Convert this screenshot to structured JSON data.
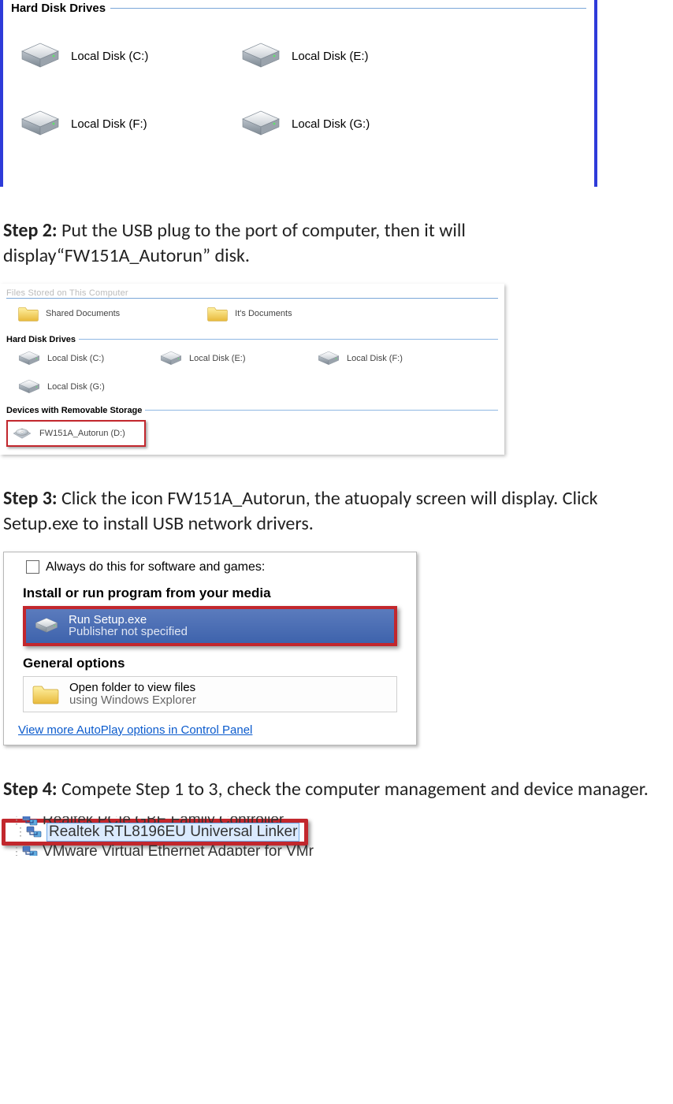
{
  "shot1": {
    "header": "Hard Disk Drives",
    "drives": [
      {
        "label": "Local Disk (C:)"
      },
      {
        "label": "Local Disk (E:)"
      },
      {
        "label": "Local Disk (F:)"
      },
      {
        "label": "Local Disk (G:)"
      }
    ]
  },
  "step2": {
    "label": "Step 2:",
    "text": " Put the USB plug to the port of computer, then it will display“FW151A_Autorun” disk."
  },
  "shot2": {
    "top_header": "Files Stored on This Computer",
    "docs": [
      {
        "label": "Shared Documents"
      },
      {
        "label": "It's Documents"
      }
    ],
    "hdd_header": "Hard Disk Drives",
    "drives": [
      {
        "label": "Local Disk (C:)"
      },
      {
        "label": "Local Disk (E:)"
      },
      {
        "label": "Local Disk (F:)"
      },
      {
        "label": "Local Disk (G:)"
      }
    ],
    "removable_header": "Devices with Removable Storage",
    "removable": {
      "label": "FW151A_Autorun (D:)"
    }
  },
  "step3": {
    "label": "Step 3:",
    "text": " Click the icon FW151A_Autorun, the atuopaly screen will display. Click Setup.exe to install USB network drivers."
  },
  "shot3": {
    "always": "Always do this for software and games:",
    "group1": "Install or run program from your media",
    "opt1_line1": "Run Setup.exe",
    "opt1_line2": "Publisher not specified",
    "group2": "General options",
    "opt2_line1": "Open folder to view files",
    "opt2_line2": "using Windows Explorer",
    "link": "View more AutoPlay options in Control Panel"
  },
  "step4": {
    "label": "Step 4:",
    "text": " Compete Step 1 to 3, check the computer management and device manager."
  },
  "shot4": {
    "row1": "Realtek PCIe GBE Family Controller",
    "row2": "Realtek RTL8196EU Universal Linker",
    "row3": "VMware Virtual Ethernet Adapter for VMr"
  }
}
